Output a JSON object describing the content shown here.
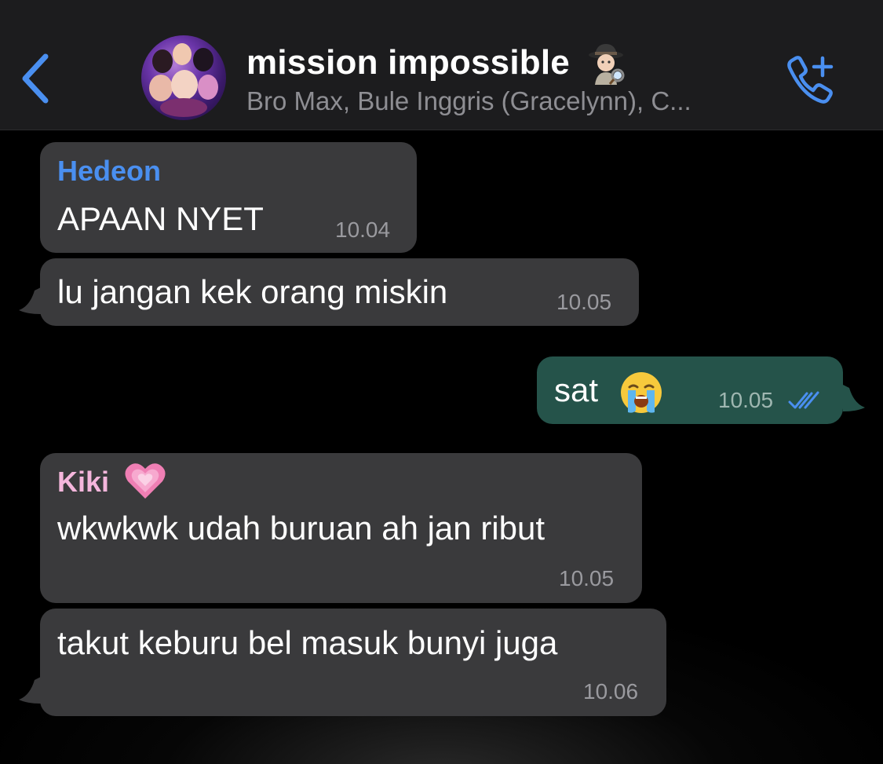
{
  "header": {
    "back_icon": "chevron-left-icon",
    "title": "mission impossible",
    "title_emoji_icon": "detective-icon",
    "members": "Bro Max, Bule Inggris (Gracelynn), C...",
    "call_icon": "add-call-icon"
  },
  "colors": {
    "accent": "#4a8ff0",
    "incoming_bubble": "#3a3a3c",
    "outgoing_bubble": "#25534a",
    "sender_hedeon": "#4a8ff0",
    "sender_kiki": "#f4b6dc"
  },
  "messages": [
    {
      "sender": "Hedeon",
      "text": "APAAN NYET",
      "time": "10.04",
      "direction": "incoming"
    },
    {
      "text": "lu jangan kek orang miskin",
      "time": "10.05",
      "direction": "incoming"
    },
    {
      "text": "sat",
      "emoji": "loudly-crying-face-icon",
      "time": "10.05",
      "direction": "outgoing",
      "status": "read-double-check-icon"
    },
    {
      "sender": "Kiki",
      "sender_emoji": "growing-heart-icon",
      "text": "wkwkwk udah buruan ah jan ribut",
      "time": "10.05",
      "direction": "incoming"
    },
    {
      "text": "takut keburu bel masuk bunyi juga",
      "time": "10.06",
      "direction": "incoming"
    }
  ]
}
